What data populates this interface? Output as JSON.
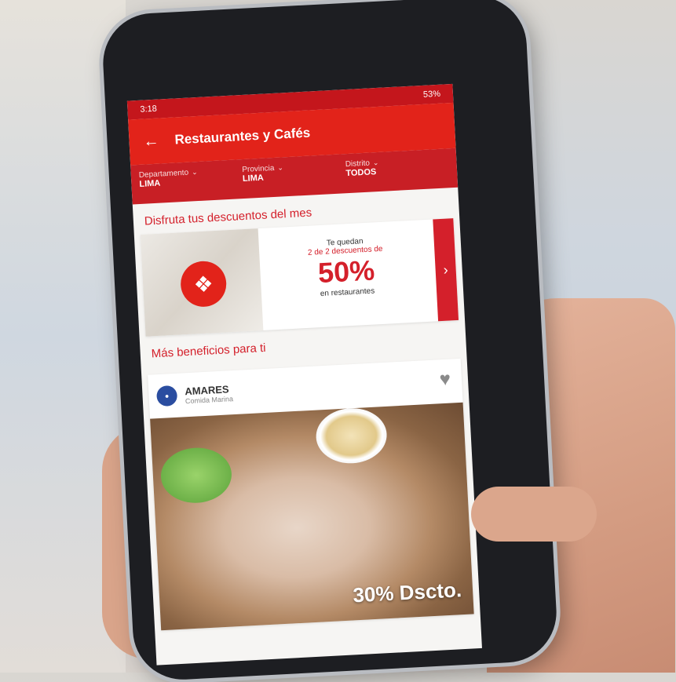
{
  "status_bar": {
    "time": "3:18",
    "right": "53%"
  },
  "app_bar": {
    "title": "Restaurantes y Cafés"
  },
  "filters": [
    {
      "label": "Departamento",
      "value": "LIMA"
    },
    {
      "label": "Provincia",
      "value": "LIMA"
    },
    {
      "label": "Distrito",
      "value": "TODOS"
    }
  ],
  "section_discounts": {
    "title": "Disfruta tus descuentos del mes"
  },
  "promo": {
    "line1": "Te quedan",
    "line2": "2 de 2 descuentos de",
    "percent": "50%",
    "line3": "en restaurantes"
  },
  "section_benefits": {
    "title": "Más beneficios para ti"
  },
  "card": {
    "name": "AMARES",
    "category": "Comida Marina",
    "discount": "30% Dscto."
  },
  "colors": {
    "brand_red": "#e2231a",
    "dark_red": "#c4161c"
  },
  "icons": [
    "back-arrow-icon",
    "chevron-down-icon",
    "fork-knife-icon",
    "chevron-right-icon",
    "heart-icon"
  ]
}
